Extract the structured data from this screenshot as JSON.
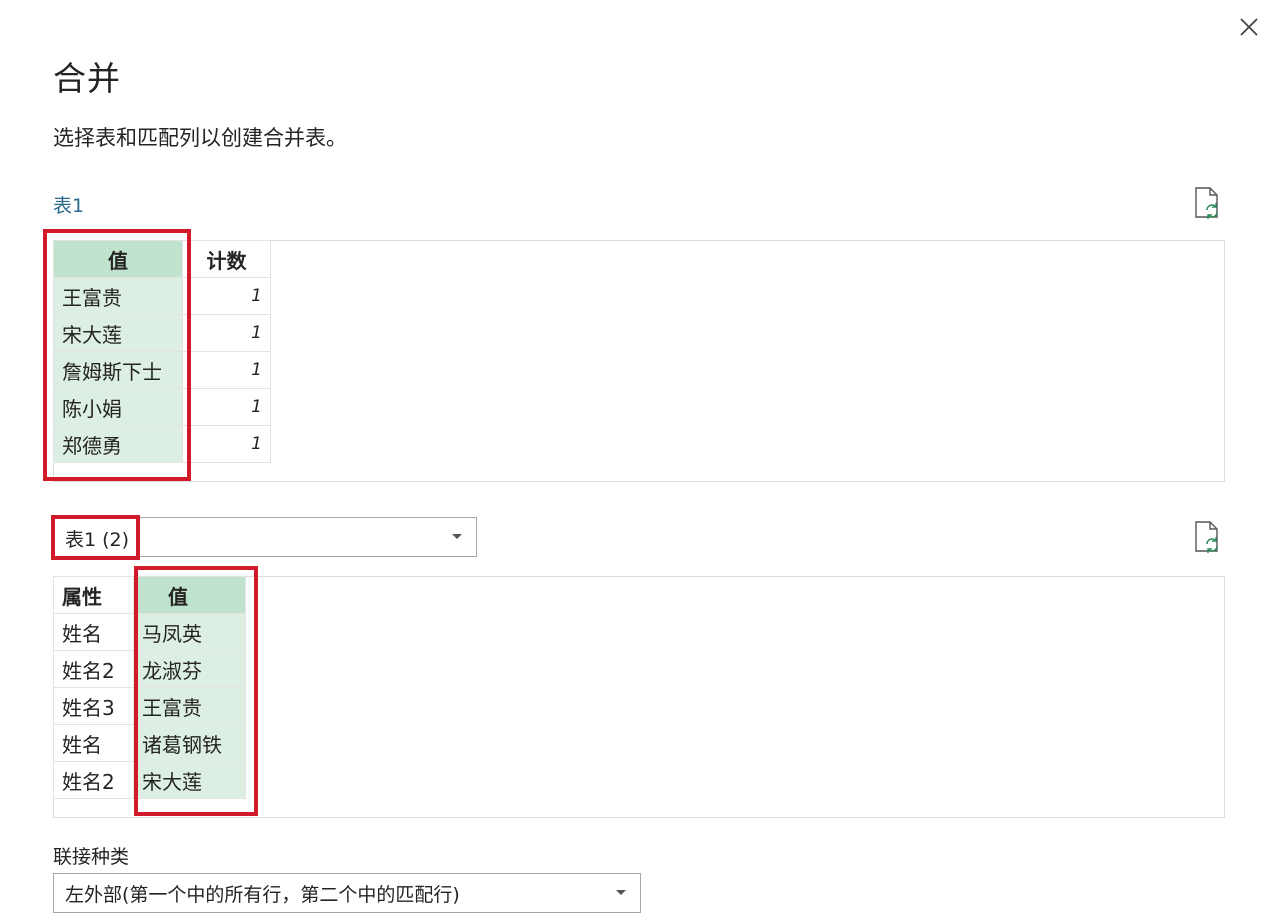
{
  "dialog": {
    "title": "合并",
    "subtitle": "选择表和匹配列以创建合并表。"
  },
  "table1": {
    "label": "表1",
    "columns": [
      "值",
      "计数"
    ],
    "rows": [
      {
        "name": "王富贵",
        "count": "1"
      },
      {
        "name": "宋大莲",
        "count": "1"
      },
      {
        "name": "詹姆斯下士",
        "count": "1"
      },
      {
        "name": "陈小娟",
        "count": "1"
      },
      {
        "name": "郑德勇",
        "count": "1"
      }
    ]
  },
  "table2": {
    "selected": "表1 (2)",
    "columns": [
      "属性",
      "值"
    ],
    "rows": [
      {
        "attr": "姓名",
        "value": "马凤英"
      },
      {
        "attr": "姓名2",
        "value": "龙淑芬"
      },
      {
        "attr": "姓名3",
        "value": "王富贵"
      },
      {
        "attr": "姓名",
        "value": "诸葛钢铁"
      },
      {
        "attr": "姓名2",
        "value": "宋大莲"
      }
    ]
  },
  "join": {
    "label": "联接种类",
    "selected": "左外部(第一个中的所有行，第二个中的匹配行)"
  },
  "colors": {
    "accent_label": "#2b6a8c",
    "selected_header": "#bfe3cc",
    "selected_cell": "#dcefe2",
    "highlight": "#d11a2a"
  }
}
